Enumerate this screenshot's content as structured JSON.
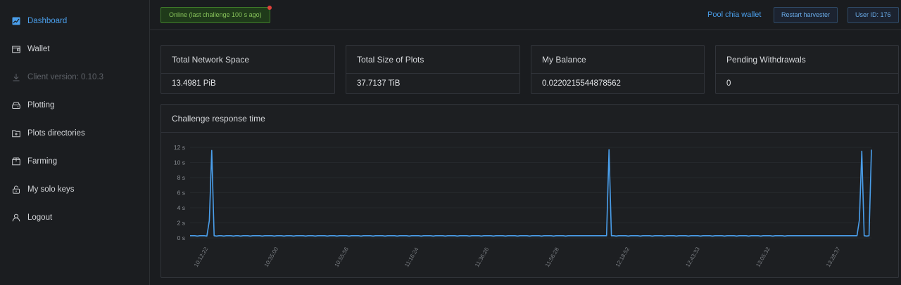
{
  "sidebar": {
    "items": [
      {
        "label": "Dashboard",
        "icon": "chart-line-icon",
        "active": true
      },
      {
        "label": "Wallet",
        "icon": "wallet-icon"
      },
      {
        "label": "Client version: 0.10.3",
        "icon": "download-icon",
        "disabled": true
      },
      {
        "label": "Plotting",
        "icon": "hdd-icon"
      },
      {
        "label": "Plots directories",
        "icon": "folder-plus-icon"
      },
      {
        "label": "Farming",
        "icon": "box-icon"
      },
      {
        "label": "My solo keys",
        "icon": "lock-icon"
      },
      {
        "label": "Logout",
        "icon": "user-icon"
      }
    ]
  },
  "topbar": {
    "status": "Online (last challenge 100 s ago)",
    "pool_link": "Pool chia wallet",
    "restart_label": "Restart harvester",
    "user_label": "User ID: 176"
  },
  "stats": [
    {
      "title": "Total Network Space",
      "value": "13.4981 PiB"
    },
    {
      "title": "Total Size of Plots",
      "value": "37.7137 TiB"
    },
    {
      "title": "My Balance",
      "value": "0.0220215544878562"
    },
    {
      "title": "Pending Withdrawals",
      "value": "0"
    }
  ],
  "chart_data": {
    "type": "line",
    "title": "Challenge response time",
    "y_unit": "s",
    "ylim": [
      0,
      12
    ],
    "y_ticks": [
      "0 s",
      "2 s",
      "4 s",
      "6 s",
      "8 s",
      "10 s",
      "12 s"
    ],
    "x_ticks": [
      "10:12:22",
      "10:35:00",
      "10:55:56",
      "11:16:24",
      "11:36:26",
      "11:56:28",
      "12:18:52",
      "12:43:33",
      "13:05:32",
      "13:28:37"
    ],
    "line_color": "#4a9eea",
    "grid": true,
    "values": [
      0.3,
      0.3,
      0.3,
      0.25,
      0.3,
      0.3,
      0.3,
      0.25,
      2.3,
      11.6,
      0.3,
      0.25,
      0.3,
      0.3,
      0.25,
      0.3,
      0.3,
      0.3,
      0.25,
      0.3,
      0.3,
      0.25,
      0.3,
      0.3,
      0.3,
      0.25,
      0.3,
      0.3,
      0.3,
      0.3,
      0.25,
      0.3,
      0.3,
      0.3,
      0.3,
      0.25,
      0.3,
      0.3,
      0.3,
      0.25,
      0.3,
      0.3,
      0.3,
      0.25,
      0.3,
      0.3,
      0.3,
      0.3,
      0.25,
      0.3,
      0.3,
      0.3,
      0.25,
      0.3,
      0.3,
      0.3,
      0.3,
      0.25,
      0.3,
      0.3,
      0.3,
      0.25,
      0.3,
      0.3,
      0.3,
      0.3,
      0.25,
      0.3,
      0.3,
      0.3,
      0.3,
      0.25,
      0.3,
      0.3,
      0.3,
      0.3,
      0.25,
      0.3,
      0.3,
      0.3,
      0.3,
      0.25,
      0.3,
      0.3,
      0.3,
      0.3,
      0.25,
      0.3,
      0.3,
      0.3,
      0.3,
      0.25,
      0.3,
      0.3,
      0.3,
      0.3,
      0.25,
      0.3,
      0.3,
      0.3,
      0.3,
      0.25,
      0.3,
      0.3,
      0.3,
      0.3,
      0.25,
      0.3,
      0.3,
      0.3,
      0.3,
      0.25,
      0.3,
      0.3,
      0.3,
      0.3,
      0.25,
      0.3,
      0.3,
      0.3,
      0.3,
      0.25,
      0.3,
      0.3,
      0.3,
      0.3,
      0.25,
      0.3,
      0.3,
      0.3,
      0.3,
      0.25,
      0.3,
      0.3,
      0.3,
      0.3,
      0.25,
      0.3,
      0.3,
      0.3,
      0.3,
      0.25,
      0.3,
      0.3,
      0.3,
      0.3,
      0.25,
      0.3,
      0.3,
      0.3,
      0.3,
      0.25,
      0.3,
      0.3,
      0.3,
      0.3,
      0.25,
      0.3,
      0.3,
      0.3,
      0.3,
      0.3,
      0.3,
      0.3,
      0.3,
      0.3,
      0.3,
      0.3,
      0.3,
      0.3,
      0.3,
      0.3,
      0.3,
      0.3,
      11.7,
      0.3,
      0.3,
      0.25,
      0.3,
      0.3,
      0.3,
      0.3,
      0.25,
      0.3,
      0.3,
      0.3,
      0.3,
      0.25,
      0.3,
      0.3,
      0.3,
      0.3,
      0.25,
      0.3,
      0.3,
      0.3,
      0.3,
      0.25,
      0.3,
      0.3,
      0.3,
      0.3,
      0.25,
      0.3,
      0.3,
      0.3,
      0.3,
      0.25,
      0.3,
      0.3,
      0.3,
      0.3,
      0.25,
      0.3,
      0.3,
      0.3,
      0.3,
      0.25,
      0.3,
      0.3,
      0.3,
      0.3,
      0.25,
      0.3,
      0.3,
      0.3,
      0.3,
      0.25,
      0.3,
      0.3,
      0.3,
      0.3,
      0.25,
      0.3,
      0.3,
      0.3,
      0.3,
      0.25,
      0.3,
      0.3,
      0.3,
      0.3,
      0.25,
      0.3,
      0.3,
      0.3,
      0.3,
      0.25,
      0.3,
      0.3,
      0.3,
      0.3,
      0.3,
      0.3,
      0.3,
      0.3,
      0.3,
      0.3,
      0.3,
      0.3,
      0.3,
      0.3,
      0.3,
      0.3,
      0.3,
      0.3,
      0.3,
      0.3,
      0.3,
      0.3,
      0.3,
      0.3,
      0.3,
      0.3,
      0.3,
      0.3,
      0.3,
      0.3,
      2.4,
      11.5,
      0.3,
      0.25,
      0.3,
      11.7
    ]
  }
}
